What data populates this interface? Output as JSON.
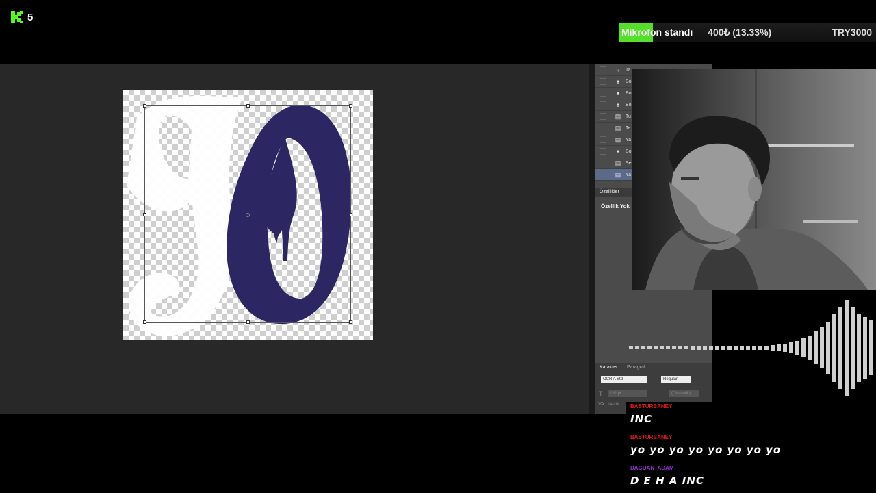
{
  "colors": {
    "kick_green": "#53fc18",
    "goal_fill": "#54e02a",
    "shape_purple": "#2c2763",
    "chat_user_red": "#e0191b",
    "chat_user_purple": "#9b2fd6"
  },
  "overlay": {
    "viewer_count": "5"
  },
  "goal": {
    "label": "Mikrofon standı",
    "amount": "400₺ (13.33%)",
    "target": "TRY3000",
    "progress": 0.1333
  },
  "layers_panel": {
    "layers": [
      {
        "name": "Ta",
        "icon": "move-icon"
      },
      {
        "name": "Bo",
        "icon": "shape-icon"
      },
      {
        "name": "Bo",
        "icon": "shape-icon"
      },
      {
        "name": "Bo",
        "icon": "shape-icon"
      },
      {
        "name": "Tu",
        "icon": "layer-icon"
      },
      {
        "name": "Te",
        "icon": "layer-icon"
      },
      {
        "name": "Ya",
        "icon": "layer-icon"
      },
      {
        "name": "Bo",
        "icon": "shape-icon"
      },
      {
        "name": "Se",
        "icon": "layer-icon"
      },
      {
        "name": "Ya",
        "icon": "layer-icon"
      }
    ],
    "properties_tab": "Özellikler",
    "properties_title": "Özellik Yok"
  },
  "character_panel": {
    "tab_character": "Karakter",
    "tab_paragraph": "Paragraf",
    "font_family": "OCR A Std",
    "font_style": "Regular",
    "font_size": "192 pt",
    "leading": "(Otomatik)",
    "kerning": "Metrik"
  },
  "chat": {
    "messages": [
      {
        "user": "BASTURBANEY",
        "text": "INC"
      },
      {
        "user": "BASTURBANEY",
        "text": "yo yo yo yo yo yo yo yo"
      },
      {
        "user": "DAGDAN_ADAM",
        "text": "D E H A INC"
      }
    ]
  }
}
